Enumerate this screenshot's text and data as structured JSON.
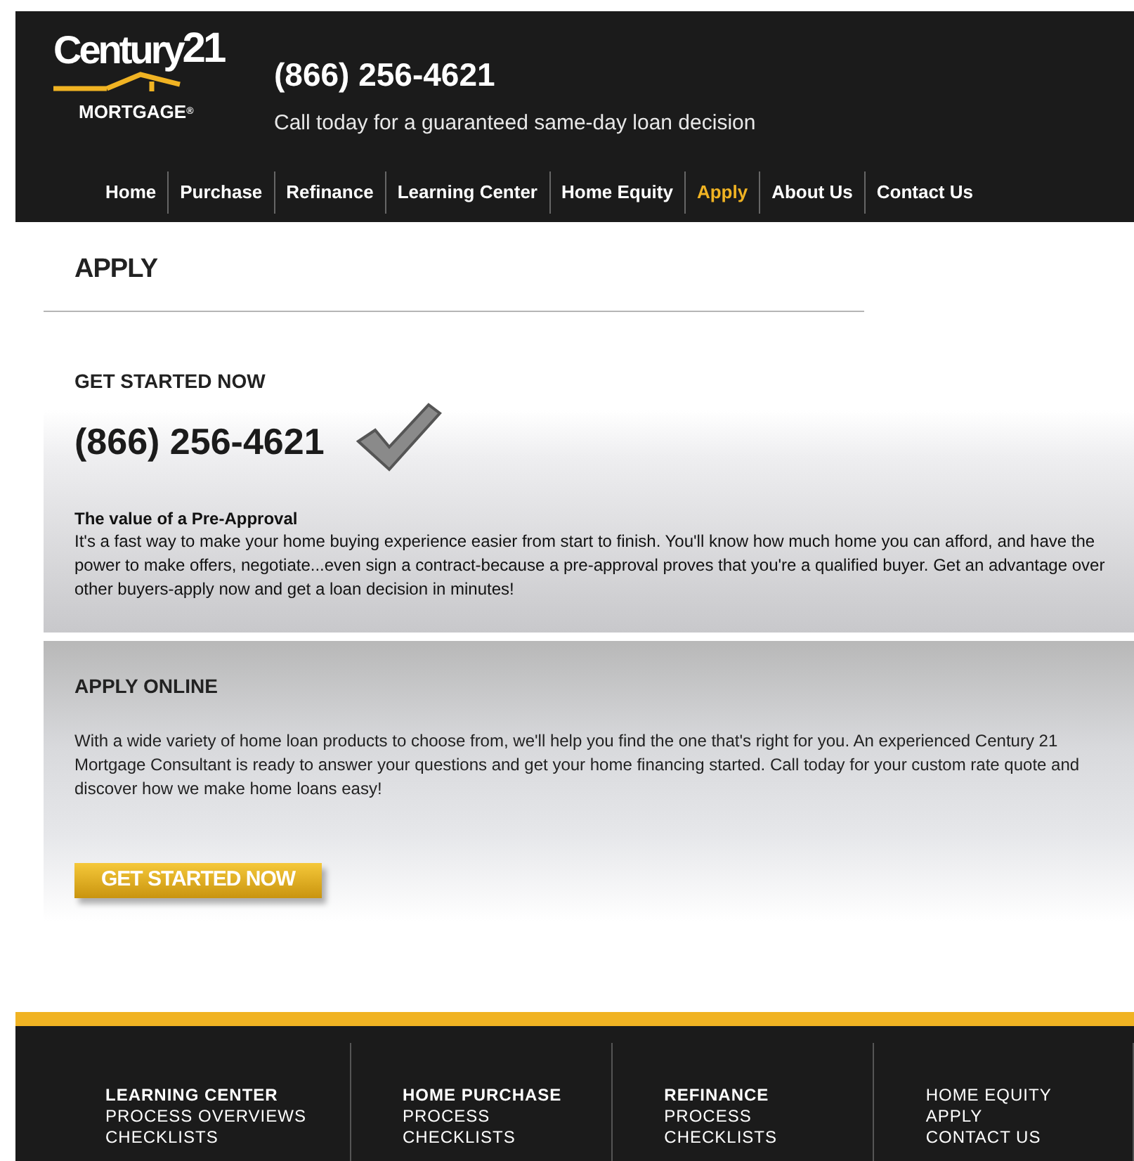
{
  "logo": {
    "wordmark": "Century",
    "number": "21",
    "sub": "MORTGAGE",
    "mark": "®"
  },
  "header": {
    "phone": "(866) 256-4621",
    "tagline": "Call today for a guaranteed same-day loan decision"
  },
  "nav": [
    {
      "label": "Home",
      "selected": false
    },
    {
      "label": "Purchase",
      "selected": false
    },
    {
      "label": "Refinance",
      "selected": false
    },
    {
      "label": "Learning Center",
      "selected": false
    },
    {
      "label": "Home Equity",
      "selected": false
    },
    {
      "label": "Apply",
      "selected": true
    },
    {
      "label": "About Us",
      "selected": false
    },
    {
      "label": "Contact Us",
      "selected": false
    }
  ],
  "page_title": "APPLY",
  "get_started": {
    "heading": "GET STARTED NOW",
    "phone": "(866) 256-4621",
    "subheading": "The value of a Pre-Approval",
    "body": "It's a fast way to make your home buying experience easier from start to finish. You'll know how much home you can afford, and have the power to make offers, negotiate...even sign a contract-because a pre-approval proves that you're a qualified buyer. Get an advantage over other buyers-apply now and get a loan decision in minutes!"
  },
  "apply_online": {
    "heading": "APPLY ONLINE",
    "body": "With a wide variety of home loan products to choose from, we'll help you find the one that's right for you. An experienced Century 21 Mortgage Consultant is ready to answer your questions and get your home financing started. Call today for your custom rate quote and discover how we make home loans easy!",
    "button": "GET STARTED NOW"
  },
  "footer": [
    {
      "heading": "LEARNING CENTER",
      "links": [
        "PROCESS OVERVIEWS",
        "CHECKLISTS"
      ]
    },
    {
      "heading": "HOME PURCHASE",
      "links": [
        "PROCESS",
        "CHECKLISTS"
      ]
    },
    {
      "heading": "REFINANCE",
      "links": [
        "PROCESS",
        "CHECKLISTS"
      ]
    },
    {
      "links": [
        "HOME EQUITY",
        "APPLY",
        "CONTACT US"
      ]
    }
  ]
}
